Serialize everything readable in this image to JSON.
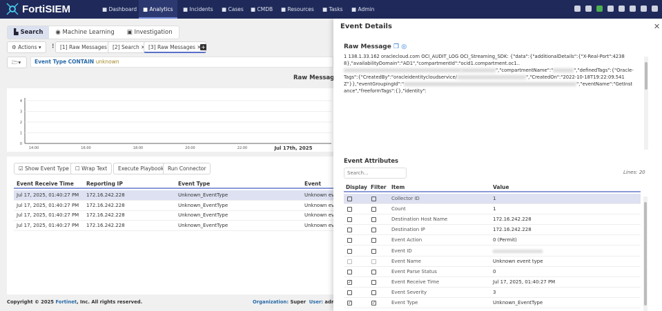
{
  "app": {
    "name": "FortiSIEM"
  },
  "nav": {
    "items": [
      {
        "label": "Dashboard",
        "icon": "dashboard-icon"
      },
      {
        "label": "Analytics",
        "icon": "chart-icon",
        "active": true
      },
      {
        "label": "Incidents",
        "icon": "bell-icon"
      },
      {
        "label": "Cases",
        "icon": "archive-icon"
      },
      {
        "label": "CMDB",
        "icon": "database-icon"
      },
      {
        "label": "Resources",
        "icon": "bar-chart-icon"
      },
      {
        "label": "Tasks",
        "icon": "list-icon"
      },
      {
        "label": "Admin",
        "icon": "gears-icon"
      }
    ],
    "right_icons": [
      "palette-icon",
      "eye-icon",
      "cloud-icon",
      "help-icon",
      "warning-icon",
      "id-card-icon",
      "user-icon",
      "logout-icon"
    ],
    "cloud_color": "#4caf50"
  },
  "modes": {
    "search": "Search",
    "ml": "Machine Learning",
    "investigation": "Investigation"
  },
  "toolbar": {
    "actions": "Actions",
    "tabs": [
      "[1] Raw Messages",
      "[2] Search",
      "[3] Raw Messages"
    ]
  },
  "query": {
    "field": "Event Type",
    "op": "CONTAIN",
    "value": "unknown"
  },
  "chart_data": {
    "type": "line",
    "title": "Raw Messages",
    "yticks": [
      "0",
      "1",
      "2",
      "3",
      "4"
    ],
    "xticks": [
      "14:00",
      "16:00",
      "18:00",
      "20:00",
      "22:00"
    ],
    "date_label": "Jul 17th, 2025",
    "ylim": [
      0,
      4
    ],
    "series": []
  },
  "results": {
    "buttons": {
      "show_event_type": "Show Event Type",
      "wrap_text": "Wrap Text",
      "execute_playbook": "Execute Playbook",
      "run_connector": "Run Connector"
    },
    "columns": [
      "Event Receive Time",
      "Reporting IP",
      "Event Type",
      "Event Name"
    ],
    "rows": [
      [
        "Jul 17, 2025, 01:40:27 PM",
        "172.16.242.228",
        "Unknown_EventType",
        "Unknown eve"
      ],
      [
        "Jul 17, 2025, 01:40:27 PM",
        "172.16.242.228",
        "Unknown_EventType",
        "Unknown eve"
      ],
      [
        "Jul 17, 2025, 01:40:27 PM",
        "172.16.242.228",
        "Unknown_EventType",
        "Unknown eve"
      ],
      [
        "Jul 17, 2025, 01:40:27 PM",
        "172.16.242.228",
        "Unknown_EventType",
        "Unknown eve"
      ]
    ]
  },
  "footer": {
    "copyright_pre": "Copyright © 2025 ",
    "brand": "Fortinet",
    "copyright_post": ", Inc. All rights reserved.",
    "org_label": "Organization:",
    "org": "Super",
    "user_label": "User:",
    "user": "admin"
  },
  "detail": {
    "title": "Event Details",
    "raw_title": "Raw Message",
    "raw_parts": [
      "1 138.1.33.162 oraclecloud.com OCI_AUDIT_LOG OCI_Streaming_SDK: {\"data\":{\"additionalDetails\":{\"X-Real-Port\":42388},\"availabilityDomain\":\"AD1\",\"compartmentId\":\"ocid1.compartment.oc1..",
      "\",\"compartmentName\":\"",
      "\",\"definedTags\":{\"Oracle-Tags\":{\"CreatedBy\":\"oracleidentitycloudservice/",
      "\",\"CreatedOn\":\"2022-10-18T19:22:09.541Z\"}},\"eventGroupingId\":\"",
      "\",\"eventName\":\"GetInstance\",\"freeformTags\":{},\"identity\":"
    ],
    "attr_title": "Event Attributes",
    "search_placeholder": "Search...",
    "lines": "Lines: 20",
    "columns": [
      "Display",
      "Filter",
      "Item",
      "Value"
    ],
    "attributes": [
      {
        "item": "Collector ID",
        "value": "1",
        "display": false,
        "filter": false
      },
      {
        "item": "Count",
        "value": "1",
        "display": false,
        "filter": false
      },
      {
        "item": "Destination Host Name",
        "value": "172.16.242.228",
        "display": false,
        "filter": false
      },
      {
        "item": "Destination IP",
        "value": "172.16.242.228",
        "display": false,
        "filter": false
      },
      {
        "item": "Event Action",
        "value": "0 (Permit)",
        "display": false,
        "filter": false
      },
      {
        "item": "Event ID",
        "value": "",
        "display": false,
        "filter": false
      },
      {
        "item": "Event Name",
        "value": "Unknown event type",
        "display": false,
        "filter": false,
        "disabled": true
      },
      {
        "item": "Event Parse Status",
        "value": "0",
        "display": false,
        "filter": false
      },
      {
        "item": "Event Receive Time",
        "value": "Jul 17, 2025, 01:40:27 PM",
        "display": true,
        "filter": false
      },
      {
        "item": "Event Severity",
        "value": "3",
        "display": false,
        "filter": false
      },
      {
        "item": "Event Type",
        "value": "Unknown_EventType",
        "display": true,
        "filter": true
      }
    ]
  }
}
